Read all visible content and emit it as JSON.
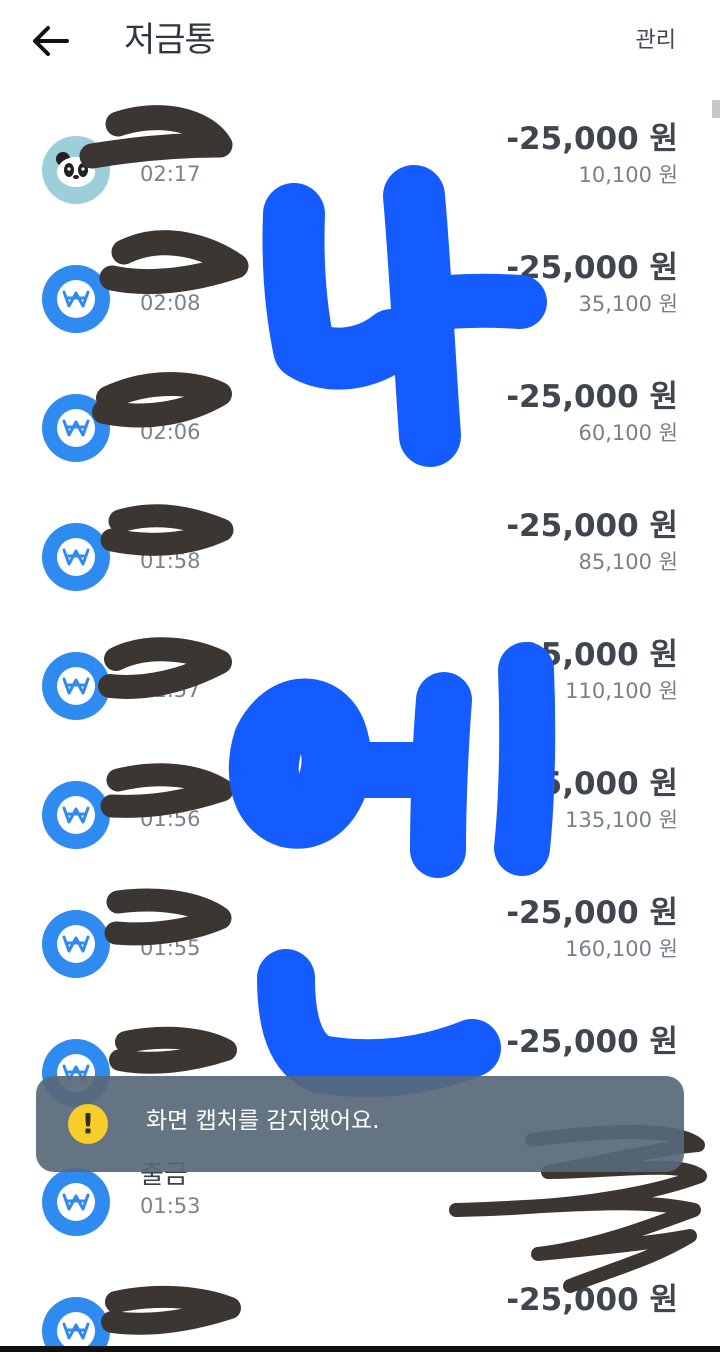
{
  "header": {
    "title": "저금통",
    "manage_label": "관리",
    "back_icon": "arrow-left-icon"
  },
  "transactions": [
    {
      "name": "",
      "time": "02:17",
      "amount": "-25,000 원",
      "balance": "10,100 원",
      "avatar": "panda-icon"
    },
    {
      "name": "",
      "time": "02:08",
      "amount": "-25,000 원",
      "balance": "35,100 원",
      "avatar": "won-icon"
    },
    {
      "name": "",
      "time": "02:06",
      "amount": "-25,000 원",
      "balance": "60,100 원",
      "avatar": "won-icon"
    },
    {
      "name": "",
      "time": "01:58",
      "amount": "-25,000 원",
      "balance": "85,100 원",
      "avatar": "won-icon"
    },
    {
      "name": "",
      "time": "01:57",
      "amount": "-25,000 원",
      "balance": "110,100 원",
      "avatar": "won-icon"
    },
    {
      "name": "",
      "time": "01:56",
      "amount": "-25,000 원",
      "balance": "135,100 원",
      "avatar": "won-icon"
    },
    {
      "name": "",
      "time": "01:55",
      "amount": "-25,000 원",
      "balance": "160,100 원",
      "avatar": "won-icon"
    },
    {
      "name": "",
      "time": "",
      "amount": "-25,000 원",
      "balance": "",
      "avatar": "won-icon"
    },
    {
      "name": "출금",
      "time": "01:53",
      "amount": "",
      "balance": "",
      "avatar": "won-icon"
    },
    {
      "name": "",
      "time": "",
      "amount": "-25,000 원",
      "balance": "",
      "avatar": "won-icon"
    }
  ],
  "toast": {
    "message": "화면 캡처를 감지했어요.",
    "icon": "warning-icon",
    "icon_glyph": "!"
  },
  "colors": {
    "accent_blue": "#2f8bf0",
    "scribble_blue": "#145cff",
    "redaction": "#3b3631",
    "toast_bg": "#586878",
    "warning": "#f6ce2a"
  }
}
